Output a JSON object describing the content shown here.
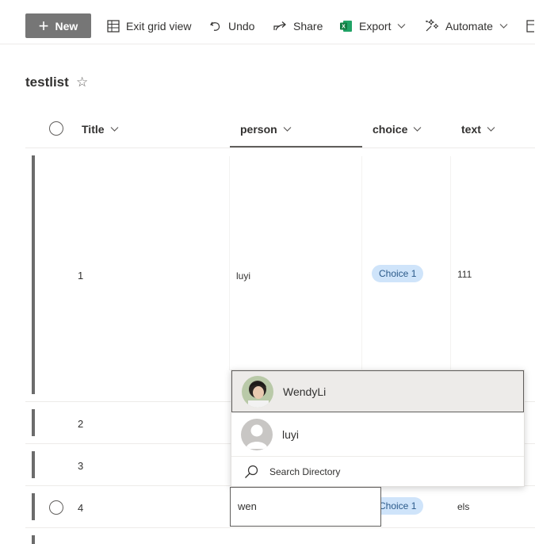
{
  "toolbar": {
    "new_label": "New",
    "exit_grid_label": "Exit grid view",
    "undo_label": "Undo",
    "share_label": "Share",
    "export_label": "Export",
    "automate_label": "Automate"
  },
  "list": {
    "title": "testlist"
  },
  "columns": {
    "title": "Title",
    "person": "person",
    "choice": "choice",
    "text": "text"
  },
  "rows": [
    {
      "title": "1",
      "person": "luyi",
      "choice": "Choice 1",
      "text": "111"
    },
    {
      "title": "2",
      "person": "",
      "choice": "",
      "text": ""
    },
    {
      "title": "3",
      "person": "",
      "choice": "",
      "text": ""
    },
    {
      "title": "4",
      "person": "",
      "choice": "Choice 1",
      "text": "els"
    }
  ],
  "people_picker": {
    "suggestions": [
      {
        "name": "WendyLi"
      },
      {
        "name": "luyi"
      }
    ],
    "search_directory_label": "Search Directory",
    "input_value": "wen"
  },
  "colors": {
    "accent_gray": "#767676",
    "choice_pill_bg": "#cfe4fa",
    "choice_pill_text": "#2b5a8a"
  }
}
